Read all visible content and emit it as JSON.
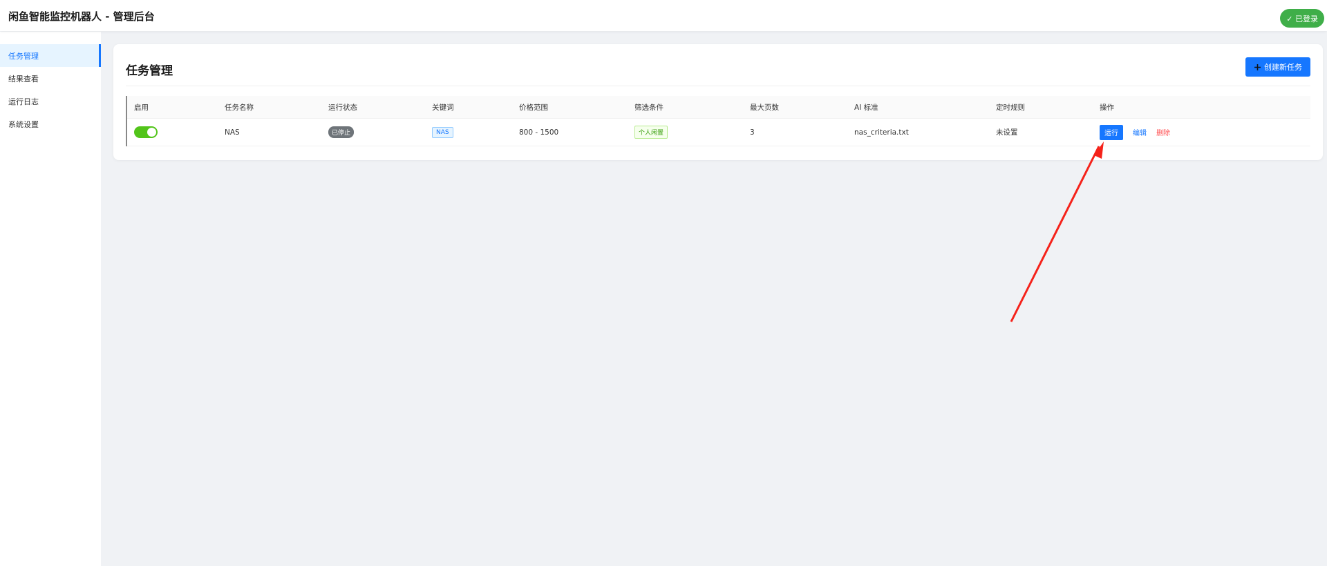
{
  "header": {
    "title": "闲鱼智能监控机器人 - 管理后台",
    "login_badge": "✓ 已登录"
  },
  "sidebar": {
    "items": [
      {
        "label": "任务管理",
        "active": true
      },
      {
        "label": "结果查看",
        "active": false
      },
      {
        "label": "运行日志",
        "active": false
      },
      {
        "label": "系统设置",
        "active": false
      }
    ]
  },
  "main": {
    "title": "任务管理",
    "create_button": "创建新任务",
    "table": {
      "headers": [
        "启用",
        "任务名称",
        "运行状态",
        "关键词",
        "价格范围",
        "筛选条件",
        "最大页数",
        "AI 标准",
        "定时规则",
        "操作"
      ],
      "rows": [
        {
          "enabled": true,
          "name": "NAS",
          "status": "已停止",
          "keyword": "NAS",
          "price_range": "800 - 1500",
          "filter": "个人闲置",
          "max_pages": "3",
          "ai_criteria": "nas_criteria.txt",
          "schedule": "未设置",
          "actions": {
            "run": "运行",
            "edit": "编辑",
            "delete": "删除"
          }
        }
      ]
    }
  },
  "colors": {
    "accent": "#1677ff",
    "success": "#52c41a",
    "danger": "#ff4d4f",
    "annotation_arrow": "#f5221a"
  }
}
